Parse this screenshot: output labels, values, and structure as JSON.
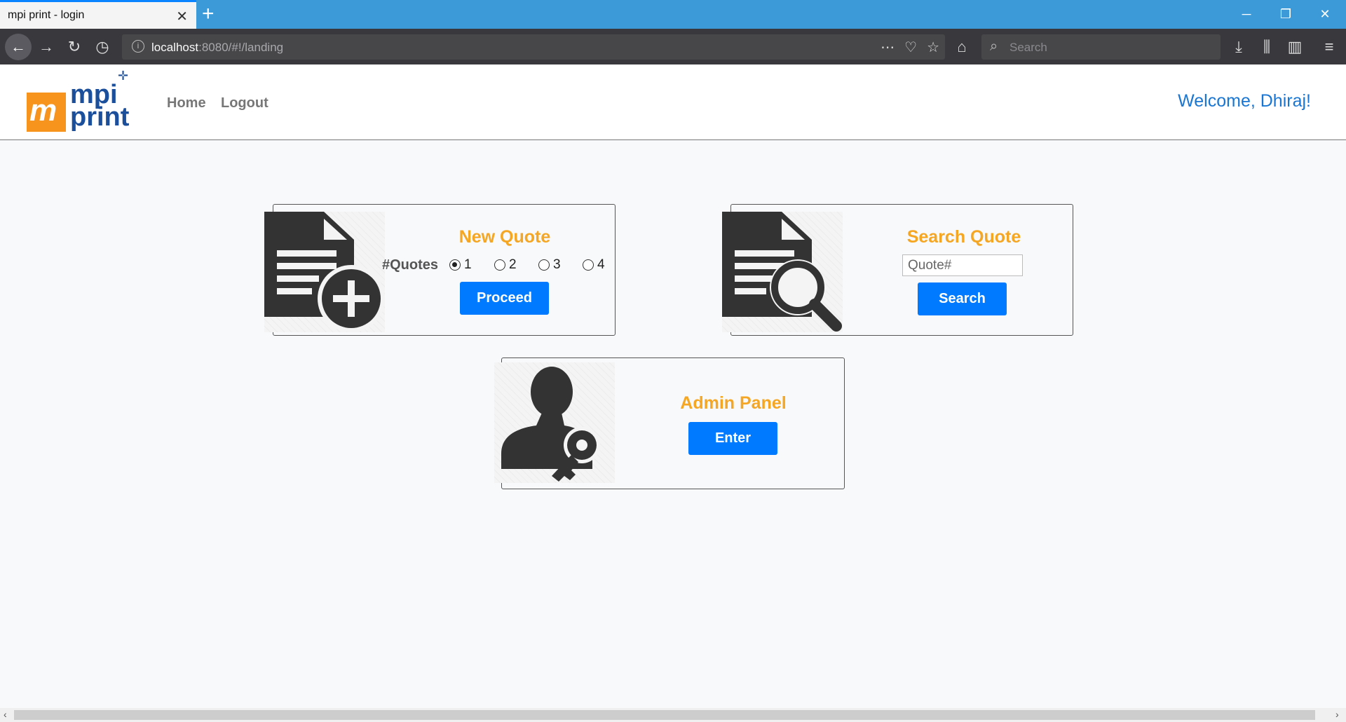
{
  "browser": {
    "tab_title": "mpi print - login",
    "url_host": "localhost",
    "url_rest": ":8080/#!/landing",
    "search_placeholder": "Search"
  },
  "header": {
    "logo_top": "mpi",
    "logo_bottom": "print",
    "nav": [
      "Home",
      "Logout"
    ],
    "welcome": "Welcome, Dhiraj!"
  },
  "new_quote": {
    "title": "New Quote",
    "count_label": "#Quotes",
    "options": [
      "1",
      "2",
      "3",
      "4"
    ],
    "selected": "1",
    "button": "Proceed"
  },
  "search_quote": {
    "title": "Search Quote",
    "placeholder": "Quote#",
    "button": "Search"
  },
  "admin_panel": {
    "title": "Admin Panel",
    "button": "Enter"
  },
  "colors": {
    "accent_orange": "#f5a623",
    "button_blue": "#007bff",
    "welcome_blue": "#1976d2",
    "tab_bar": "#3c9ad8"
  }
}
